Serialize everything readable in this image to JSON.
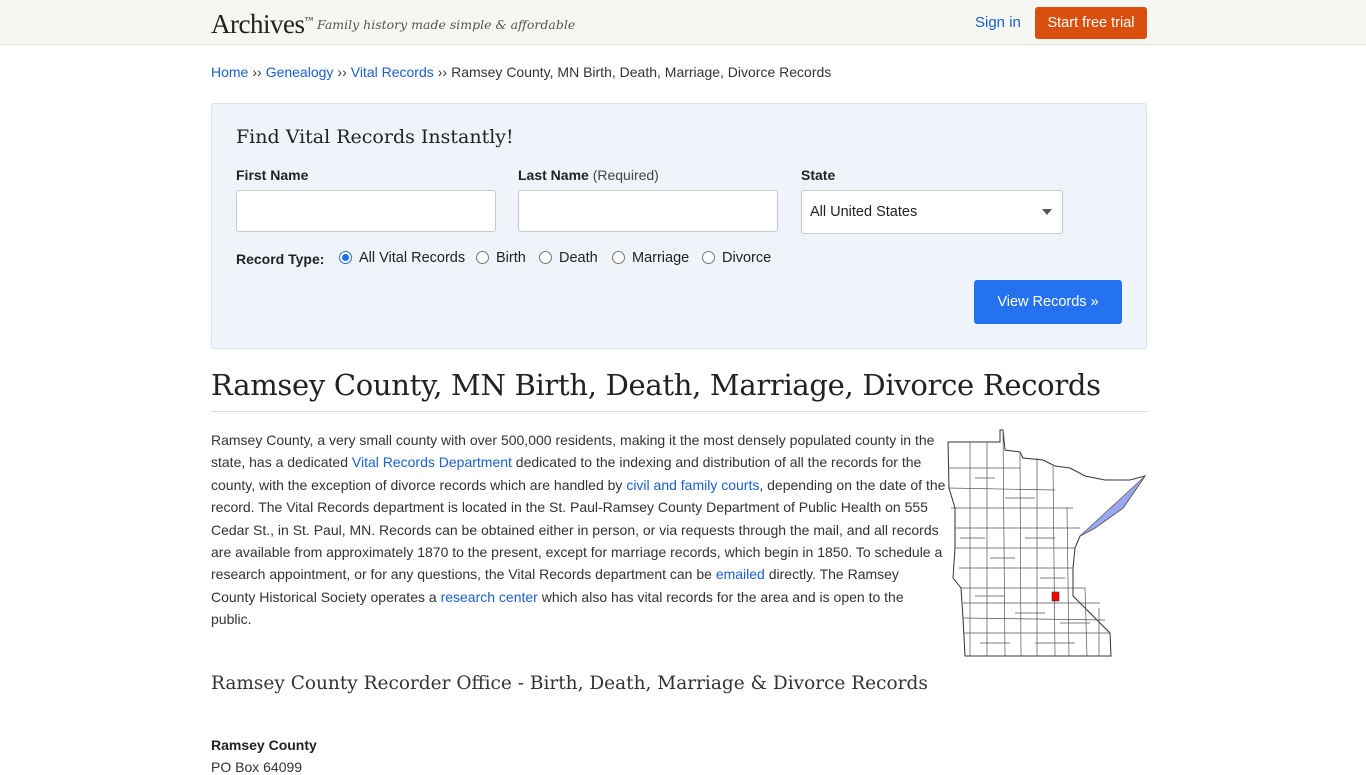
{
  "header": {
    "logo": "Archives",
    "logo_tm": "™",
    "tagline": "Family history made simple & affordable",
    "signin": "Sign in",
    "trial": "Start free trial"
  },
  "breadcrumb": {
    "items": [
      "Home",
      "Genealogy",
      "Vital Records"
    ],
    "separator": "››",
    "current": "Ramsey County, MN Birth, Death, Marriage, Divorce Records"
  },
  "search": {
    "title": "Find Vital Records Instantly!",
    "first_name_label": "First Name",
    "last_name_label": "Last Name",
    "last_name_req": "(Required)",
    "state_label": "State",
    "state_value": "All United States",
    "record_type_label": "Record Type:",
    "radios": [
      "All Vital Records",
      "Birth",
      "Death",
      "Marriage",
      "Divorce"
    ],
    "selected_radio": "All Vital Records",
    "button": "View Records »",
    "first_name_value": "",
    "last_name_value": ""
  },
  "main": {
    "title": "Ramsey County, MN Birth, Death, Marriage, Divorce Records",
    "para": {
      "t1": "Ramsey County, a very small county with over 500,000 residents, making it the most densely populated county in the state, has a dedicated ",
      "l1": "Vital Records Department",
      "t2": " dedicated to the indexing and distribution of all the records for the county, with the exception of divorce records which are handled by ",
      "l2": "civil and family courts",
      "t3": ", depending on the date of the record. The Vital Records department is located in the St. Paul-Ramsey County Department of Public Health on 555 Cedar St., in St. Paul, MN. Records can be obtained either in person, or via requests through the mail, and all records are available from approximately 1870 to the present, except for marriage records, which begin in 1850. To schedule a research appointment, or for any questions, the Vital Records department can be ",
      "l3": "emailed",
      "t4": " directly. The Ramsey County Historical Society operates a ",
      "l4": "research center",
      "t5": " which also has vital records for the area and is open to the public."
    },
    "subheading": "Ramsey County Recorder Office - Birth, Death, Marriage & Divorce Records",
    "address_name": "Ramsey County",
    "address_line1": "PO Box 64099"
  },
  "colors": {
    "accent_orange": "#d94f0e",
    "button_blue": "#2572f0",
    "link_blue": "#1a5fd1",
    "map_highlight": "#ff0000",
    "map_lake": "#9aa8f0"
  }
}
